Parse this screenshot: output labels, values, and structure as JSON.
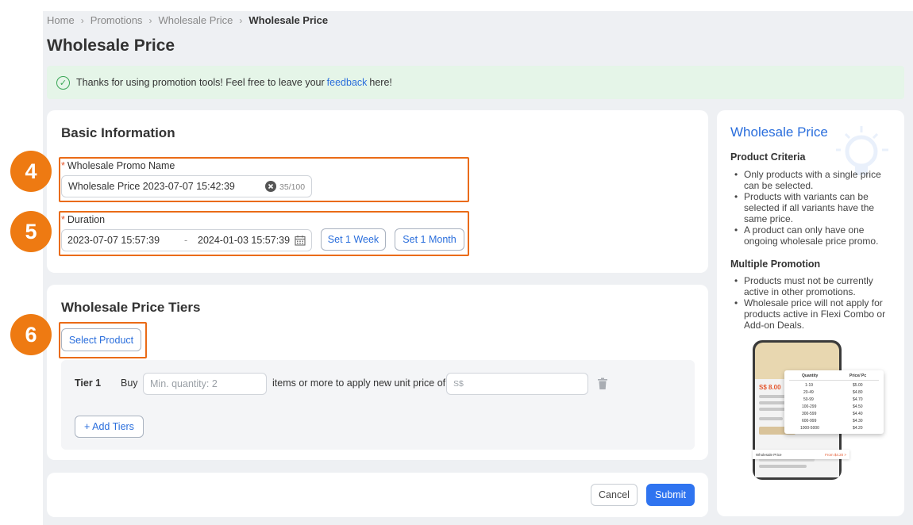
{
  "breadcrumb": [
    "Home",
    "Promotions",
    "Wholesale Price",
    "Wholesale Price"
  ],
  "page_title": "Wholesale Price",
  "notice": {
    "text_before": "Thanks for using promotion tools! Feel free to leave your",
    "link": "feedback",
    "text_after": "here!"
  },
  "basic_info": {
    "title": "Basic Information",
    "name_label": "Wholesale Promo Name",
    "name_value": "Wholesale Price 2023-07-07 15:42:39",
    "name_counter": "35/100",
    "duration_label": "Duration",
    "start": "2023-07-07 15:57:39",
    "dash": "-",
    "end": "2024-01-03 15:57:39",
    "set_week": "Set 1 Week",
    "set_month": "Set 1 Month"
  },
  "tiers": {
    "title": "Wholesale Price Tiers",
    "select_product": "Select Product",
    "tier_label": "Tier 1",
    "buy": "Buy",
    "qty_placeholder": "Min. quantity: 2",
    "middle_text": "items or more to apply new unit price of",
    "price_placeholder": "S$",
    "add_tiers": "+ Add Tiers"
  },
  "actions": {
    "cancel": "Cancel",
    "submit": "Submit"
  },
  "steps": [
    "4",
    "5",
    "6"
  ],
  "sidebar": {
    "title": "Wholesale Price",
    "criteria_heading": "Product Criteria",
    "criteria": [
      "Only products with a single price can be selected.",
      "Products with variants can be selected if all variants have the same price.",
      "A product can only have one ongoing wholesale price promo."
    ],
    "multiple_heading": "Multiple Promotion",
    "multiple": [
      "Products must not be currently active in other promotions.",
      "Wholesale price will not apply for products active in Flexi Combo or Add-on Deals."
    ],
    "illustration": {
      "price": "S$ 8.00",
      "table_headers": [
        "Quantity",
        "Price/ Pc"
      ],
      "rows": [
        [
          "1-19",
          "$5.00"
        ],
        [
          "20-49",
          "$4.80"
        ],
        [
          "50-99",
          "$4.70"
        ],
        [
          "100-299",
          "$4.50"
        ],
        [
          "300-599",
          "$4.40"
        ],
        [
          "600-999",
          "$4.30"
        ],
        [
          "1000-5000",
          "$4.20"
        ]
      ],
      "strip_left": "Wholesale Price",
      "strip_right": "From $4.20 >"
    }
  },
  "colors": {
    "accent": "#2f74f0",
    "highlight": "#ea6b16",
    "notice_bg": "#e5f5e8"
  }
}
